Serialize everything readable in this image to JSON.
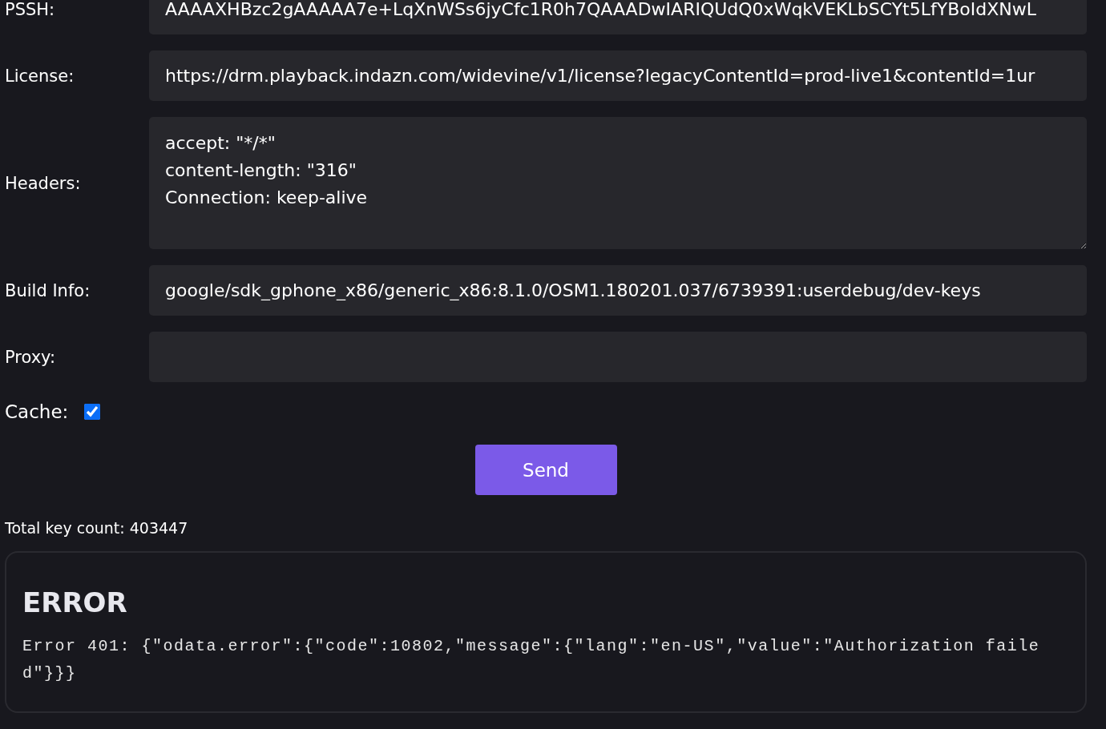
{
  "form": {
    "fields": [
      {
        "kind": "input",
        "label": "PSSH:",
        "value": "AAAAXHBzc2gAAAAA7e+LqXnWSs6jyCfc1R0h7QAAADwIARIQUdQ0xWqkVEKLbSCYt5LfYBoIdXNwL"
      },
      {
        "kind": "input",
        "label": "License:",
        "value": "https://drm.playback.indazn.com/widevine/v1/license?legacyContentId=prod-live1&contentId=1ur"
      },
      {
        "kind": "textarea",
        "label": "Headers:",
        "value": "accept: \"*/*\"\ncontent-length: \"316\"\nConnection: keep-alive"
      },
      {
        "kind": "input",
        "label": "Build Info:",
        "value": "google/sdk_gphone_x86/generic_x86:8.1.0/OSM1.180201.037/6739391:userdebug/dev-keys"
      },
      {
        "kind": "input",
        "label": "Proxy:"
      },
      {
        "kind": "checkbox",
        "label": "Cache:",
        "checked": true
      }
    ],
    "submit": "Send"
  },
  "key_count": "Total key count: 403447",
  "error": {
    "title": "ERROR",
    "message": "Error 401: {\"odata.error\":{\"code\":10802,\"message\":{\"lang\":\"en-US\",\"value\":\"Authorization failed\"}}}"
  }
}
